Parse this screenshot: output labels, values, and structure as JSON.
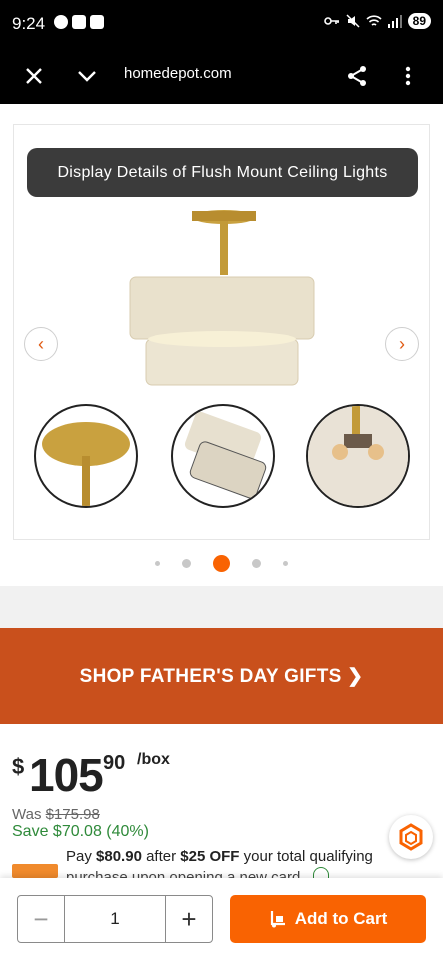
{
  "status": {
    "time": "9:24",
    "battery": "89"
  },
  "browser": {
    "url": "homedepot.com"
  },
  "gallery": {
    "title": "Display Details of Flush Mount Ceiling Lights",
    "active_index": 2,
    "dot_count": 5
  },
  "promo": {
    "label": "SHOP FATHER'S DAY GIFTS ❯"
  },
  "price": {
    "dollar": "$",
    "main": "105",
    "cents": "90",
    "unit": "/box",
    "was_label": "Was",
    "was_value": "$175.98",
    "save": "Save $70.08 (40%)"
  },
  "financing": {
    "pay_prefix": "Pay",
    "pay_amount": "$80.90",
    "after": "after",
    "off": "$25 OFF",
    "rest": "your total qualifying",
    "line2": "purchase upon opening a new card"
  },
  "cart": {
    "quantity": "1",
    "minus": "−",
    "plus": "+",
    "add_label": "Add to Cart"
  },
  "colors": {
    "accent": "#f96302",
    "promo": "#c9501c",
    "save": "#2f8a3a"
  }
}
